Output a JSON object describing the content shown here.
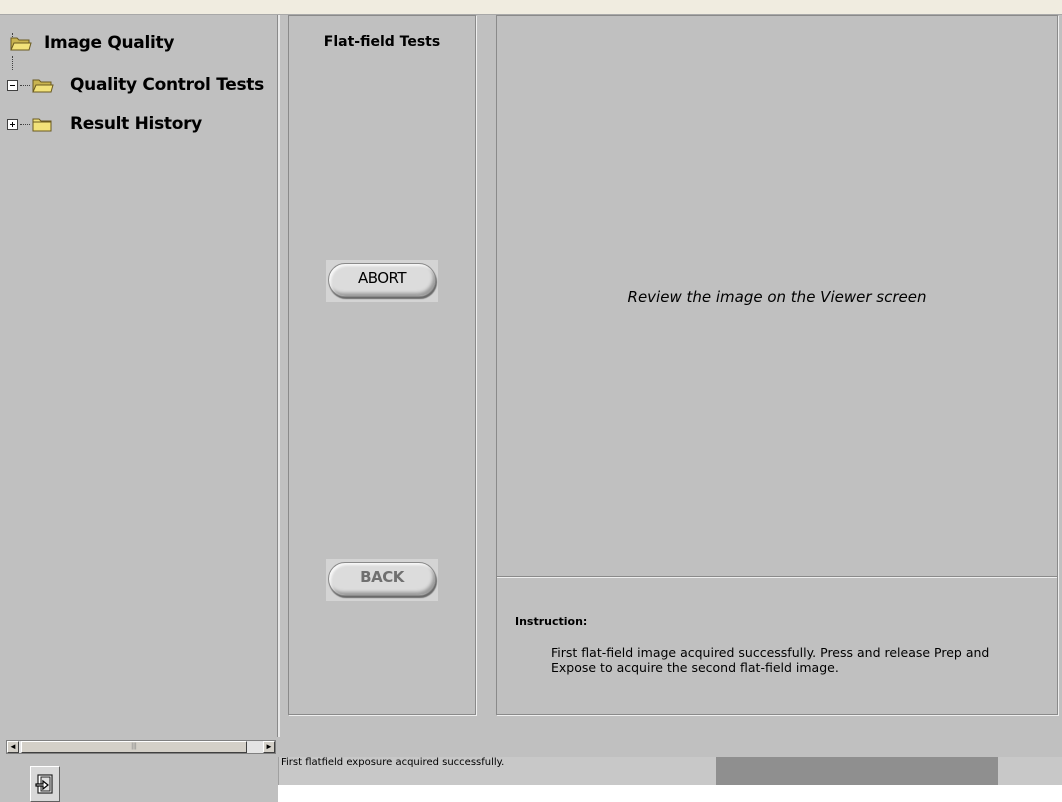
{
  "tree": {
    "items": [
      {
        "label": "Image Quality",
        "icon": "open-folder-icon"
      },
      {
        "label": "Quality Control Tests",
        "icon": "open-folder-icon",
        "expander": "collapse-icon"
      },
      {
        "label": "Result History",
        "icon": "closed-folder-icon",
        "expander": "expand-icon"
      }
    ]
  },
  "scrollbar": {
    "left_arrow": "◄",
    "right_arrow": "►",
    "grip": "|||"
  },
  "test_panel": {
    "title": "Flat-field Tests",
    "abort_label": "ABORT",
    "back_label": "BACK"
  },
  "viewer": {
    "message": "Review the image on the Viewer screen"
  },
  "instruction": {
    "label": "Instruction:",
    "text": "First flat-field image acquired successfully. Press and release Prep and Expose to acquire the second flat-field image."
  },
  "status": {
    "message": "First flatfield exposure acquired successfully."
  },
  "colors": {
    "background": "#c0c0c0",
    "folder": "#f2e27a",
    "progress": "#8f8f8f"
  }
}
